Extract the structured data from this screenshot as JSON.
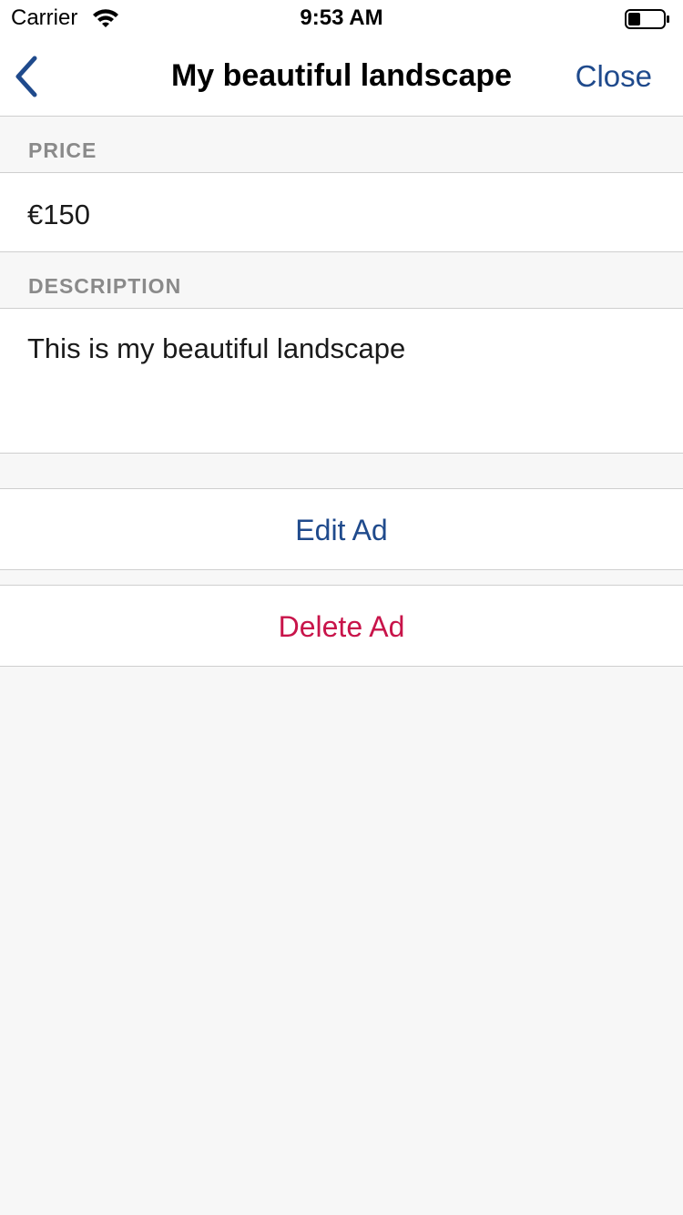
{
  "status_bar": {
    "carrier": "Carrier",
    "time": "9:53 AM",
    "wifi_icon": "wifi-icon",
    "battery_icon": "battery-icon"
  },
  "nav": {
    "back_icon": "chevron-left-icon",
    "title": "My beautiful landscape",
    "close_label": "Close"
  },
  "price": {
    "header": "PRICE",
    "value": "€150"
  },
  "description": {
    "header": "DESCRIPTION",
    "value": "This is my beautiful landscape"
  },
  "actions": {
    "edit_label": "Edit Ad",
    "delete_label": "Delete Ad"
  },
  "colors": {
    "accent": "#1f4a8c",
    "destructive": "#c8144a",
    "section_header": "#8a8a8a",
    "background": "#f7f7f7"
  }
}
